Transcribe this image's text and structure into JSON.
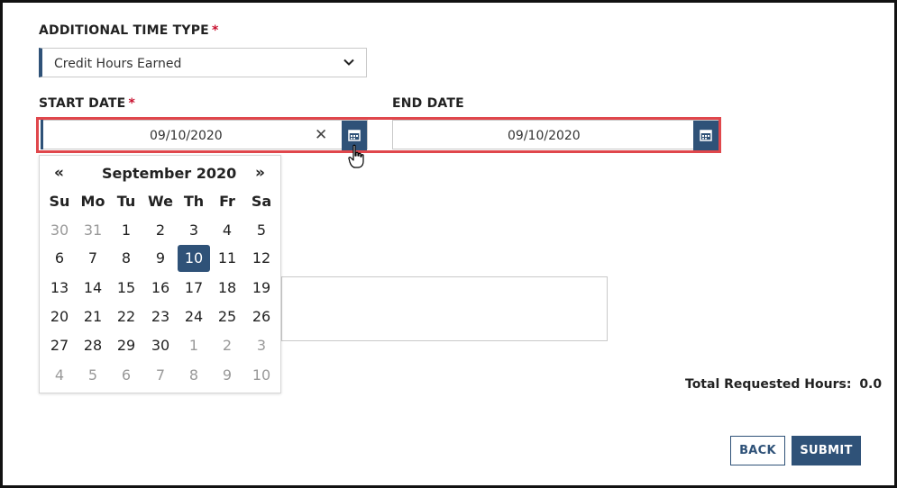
{
  "form": {
    "time_type_label": "ADDITIONAL TIME TYPE",
    "required_mark": "*",
    "time_type_value": "Credit Hours Earned",
    "start_date_label": "START DATE",
    "start_date_value": "09/10/2020",
    "clear_symbol": "✕",
    "end_date_label": "END DATE",
    "end_date_value": "09/10/2020",
    "total_hours_label": "Total Requested Hours:",
    "total_hours_value": "0.0"
  },
  "calendar": {
    "prev": "«",
    "next": "»",
    "month_title": "September 2020",
    "weekdays": [
      "Su",
      "Mo",
      "Tu",
      "We",
      "Th",
      "Fr",
      "Sa"
    ],
    "weeks": [
      [
        "30",
        "31",
        "1",
        "2",
        "3",
        "4",
        "5"
      ],
      [
        "6",
        "7",
        "8",
        "9",
        "10",
        "11",
        "12"
      ],
      [
        "13",
        "14",
        "15",
        "16",
        "17",
        "18",
        "19"
      ],
      [
        "20",
        "21",
        "22",
        "23",
        "24",
        "25",
        "26"
      ],
      [
        "27",
        "28",
        "29",
        "30",
        "1",
        "2",
        "3"
      ],
      [
        "4",
        "5",
        "6",
        "7",
        "8",
        "9",
        "10"
      ]
    ],
    "selected_day": "10"
  },
  "buttons": {
    "back": "BACK",
    "submit": "SUBMIT"
  },
  "colors": {
    "primary": "#2f5278",
    "highlight": "#e0474c",
    "required": "#c8102e"
  },
  "icons": {
    "dropdown": "chevron-down-icon",
    "calendar": "calendar-icon",
    "clear": "close-icon",
    "cursor": "hand-pointer-icon"
  }
}
